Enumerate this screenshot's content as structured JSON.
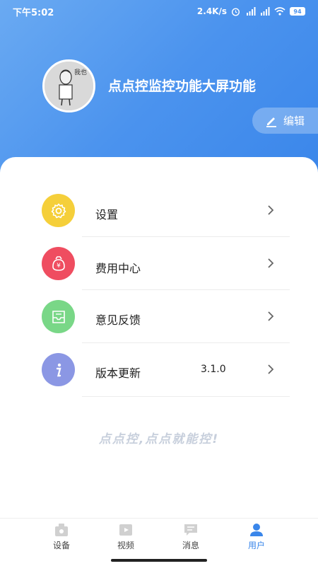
{
  "status_bar": {
    "time": "下午5:02",
    "network_speed": "2.4K/s",
    "battery": "94"
  },
  "profile": {
    "avatar_caption": "我也",
    "username": "点点控监控功能大屏功能",
    "edit_label": "编辑"
  },
  "menu": {
    "items": [
      {
        "label": "设置",
        "icon": "gear-icon",
        "color": "#f5cf3a",
        "value": ""
      },
      {
        "label": "费用中心",
        "icon": "money-bag-icon",
        "color": "#ef4d60",
        "value": ""
      },
      {
        "label": "意见反馈",
        "icon": "mail-icon",
        "color": "#79d787",
        "value": ""
      },
      {
        "label": "版本更新",
        "icon": "info-icon",
        "color": "#8b97e4",
        "value": "3.1.0"
      }
    ]
  },
  "slogan": "点点控,点点就能控!",
  "tabbar": {
    "tabs": [
      {
        "label": "设备",
        "icon": "device-icon",
        "active": false
      },
      {
        "label": "视频",
        "icon": "video-icon",
        "active": false
      },
      {
        "label": "消息",
        "icon": "message-icon",
        "active": false
      },
      {
        "label": "用户",
        "icon": "user-icon",
        "active": true
      }
    ]
  },
  "colors": {
    "header_start": "#6aaaf2",
    "header_end": "#3a86ea",
    "accent": "#3a86ea"
  }
}
